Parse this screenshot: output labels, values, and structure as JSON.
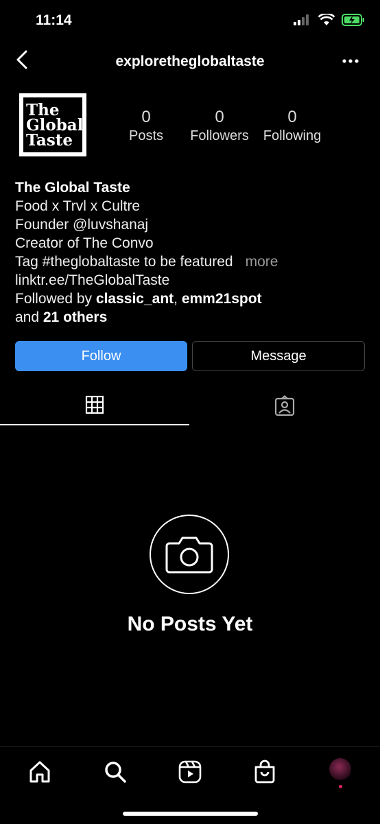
{
  "status_bar": {
    "time": "11:14"
  },
  "header": {
    "username": "exploretheglobaltaste"
  },
  "avatar": {
    "logo_lines": [
      "The",
      "Global",
      "Taste"
    ]
  },
  "stats": [
    {
      "value": "0",
      "label": "Posts"
    },
    {
      "value": "0",
      "label": "Followers"
    },
    {
      "value": "0",
      "label": "Following"
    }
  ],
  "bio": {
    "name": "The Global Taste",
    "lines": [
      "Food x Trvl x Cultre",
      "Founder @luvshanaj",
      "Creator of The Convo",
      "Tag #theglobaltaste to be featured"
    ],
    "more": "more",
    "link": "linktr.ee/TheGlobalTaste",
    "followed_prefix": "Followed by ",
    "followed_user1": "classic_ant",
    "followed_sep": ", ",
    "followed_user2": "emm21spot",
    "followed_and": "and ",
    "followed_others": "21 others"
  },
  "buttons": {
    "follow": "Follow",
    "message": "Message"
  },
  "empty_state": {
    "text": "No Posts Yet"
  },
  "colors": {
    "follow_blue": "#3a8ff0",
    "more_gray": "#9a9a9a",
    "notification_dot": "#e0245e"
  },
  "icons": [
    "back-icon",
    "more-icon",
    "grid-icon",
    "tagged-icon",
    "camera-icon",
    "home-icon",
    "search-icon",
    "reels-icon",
    "shop-icon"
  ]
}
